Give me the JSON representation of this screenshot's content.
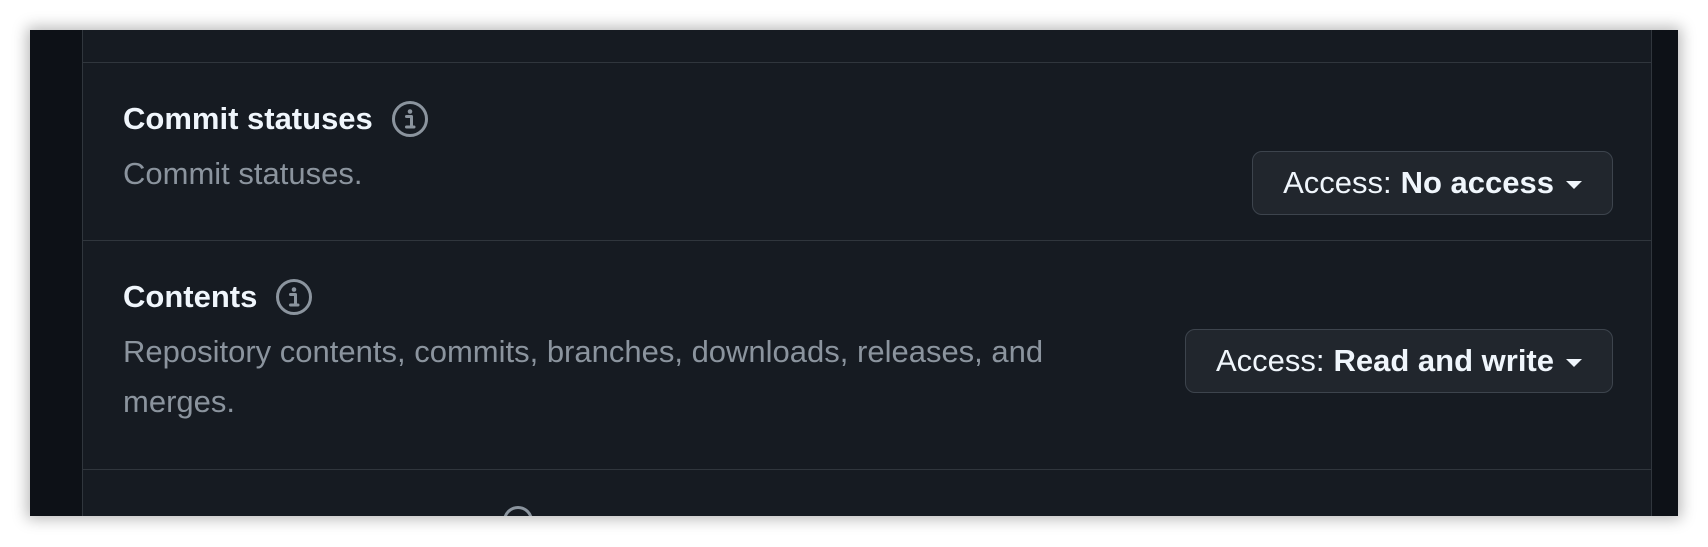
{
  "permissions": [
    {
      "title": "Commit statuses",
      "description": "Commit statuses.",
      "access_prefix": "Access:",
      "access_value": "No access"
    },
    {
      "title": "Contents",
      "description": "Repository contents, commits, branches, downloads, releases, and merges.",
      "access_prefix": "Access:",
      "access_value": "Read and write"
    }
  ],
  "icons": {
    "info": "info-circle-icon",
    "dropdown": "triangle-down-icon"
  },
  "colors": {
    "background": "#0d1117",
    "panel": "#161b22",
    "border": "#30363d",
    "text_primary": "#f0f6fc",
    "text_muted": "#8b949e",
    "button_bg": "#21262d"
  }
}
